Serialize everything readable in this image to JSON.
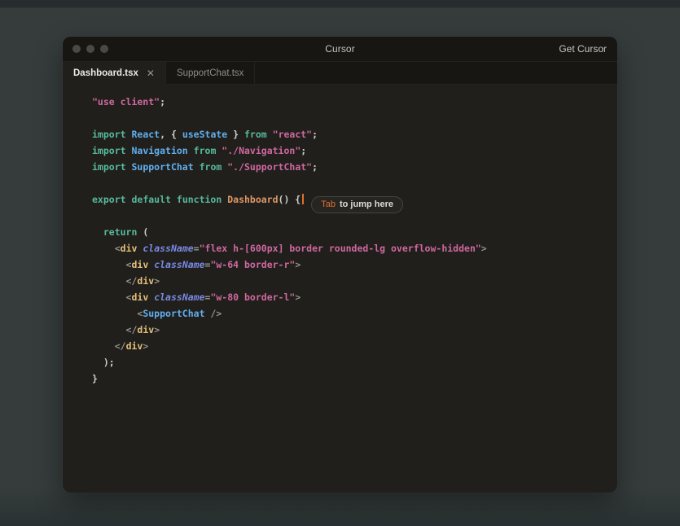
{
  "window": {
    "title": "Cursor",
    "action": "Get Cursor"
  },
  "tabs": [
    {
      "label": "Dashboard.tsx",
      "active": true
    },
    {
      "label": "SupportChat.tsx",
      "active": false
    }
  ],
  "icons": {
    "close_tab": "✕"
  },
  "inline_hint": {
    "key": "Tab",
    "text": "to jump here"
  },
  "colors": {
    "accent": "#e0702f",
    "keyword": "#57b99d",
    "component": "#61afef",
    "string": "#cf68a0",
    "tag": "#e5c07b",
    "attr": "#7b89e5",
    "func": "#dd9866",
    "plain": "#cfcfcb",
    "punct": "#95958f"
  },
  "code": {
    "lines": [
      [
        {
          "t": "\"use client\"",
          "c": "string"
        },
        {
          "t": ";",
          "c": "plain"
        }
      ],
      [],
      [
        {
          "t": "import",
          "c": "keyword"
        },
        {
          "t": " ",
          "c": "plain"
        },
        {
          "t": "React",
          "c": "component"
        },
        {
          "t": ", ",
          "c": "plain"
        },
        {
          "t": "{ ",
          "c": "plain"
        },
        {
          "t": "useState",
          "c": "component"
        },
        {
          "t": " } ",
          "c": "plain"
        },
        {
          "t": "from",
          "c": "keyword"
        },
        {
          "t": " ",
          "c": "plain"
        },
        {
          "t": "\"react\"",
          "c": "string"
        },
        {
          "t": ";",
          "c": "plain"
        }
      ],
      [
        {
          "t": "import",
          "c": "keyword"
        },
        {
          "t": " ",
          "c": "plain"
        },
        {
          "t": "Navigation",
          "c": "component"
        },
        {
          "t": " ",
          "c": "plain"
        },
        {
          "t": "from",
          "c": "keyword"
        },
        {
          "t": " ",
          "c": "plain"
        },
        {
          "t": "\"./Navigation\"",
          "c": "string"
        },
        {
          "t": ";",
          "c": "plain"
        }
      ],
      [
        {
          "t": "import",
          "c": "keyword"
        },
        {
          "t": " ",
          "c": "plain"
        },
        {
          "t": "SupportChat",
          "c": "component"
        },
        {
          "t": " ",
          "c": "plain"
        },
        {
          "t": "from",
          "c": "keyword"
        },
        {
          "t": " ",
          "c": "plain"
        },
        {
          "t": "\"./SupportChat\"",
          "c": "string"
        },
        {
          "t": ";",
          "c": "plain"
        }
      ],
      [],
      [
        {
          "t": "export",
          "c": "keyword"
        },
        {
          "t": " ",
          "c": "plain"
        },
        {
          "t": "default",
          "c": "keyword"
        },
        {
          "t": " ",
          "c": "plain"
        },
        {
          "t": "function",
          "c": "keyword"
        },
        {
          "t": " ",
          "c": "plain"
        },
        {
          "t": "Dashboard",
          "c": "func"
        },
        {
          "t": "() {",
          "c": "plain"
        },
        {
          "k": "cursor"
        },
        {
          "k": "hint"
        }
      ],
      [],
      [
        {
          "t": "  ",
          "c": "plain"
        },
        {
          "t": "return",
          "c": "keyword"
        },
        {
          "t": " (",
          "c": "plain"
        }
      ],
      [
        {
          "t": "    ",
          "c": "plain"
        },
        {
          "t": "<",
          "c": "punct"
        },
        {
          "t": "div",
          "c": "tag"
        },
        {
          "t": " ",
          "c": "plain"
        },
        {
          "t": "className",
          "c": "attr",
          "i": true
        },
        {
          "t": "=",
          "c": "punct"
        },
        {
          "t": "\"flex h-[600px] border rounded-lg overflow-hidden\"",
          "c": "string"
        },
        {
          "t": ">",
          "c": "punct"
        }
      ],
      [
        {
          "t": "      ",
          "c": "plain"
        },
        {
          "t": "<",
          "c": "punct"
        },
        {
          "t": "div",
          "c": "tag"
        },
        {
          "t": " ",
          "c": "plain"
        },
        {
          "t": "className",
          "c": "attr",
          "i": true
        },
        {
          "t": "=",
          "c": "punct"
        },
        {
          "t": "\"w-64 border-r\"",
          "c": "string"
        },
        {
          "t": ">",
          "c": "punct"
        }
      ],
      [
        {
          "t": "      ",
          "c": "plain"
        },
        {
          "t": "</",
          "c": "punct"
        },
        {
          "t": "div",
          "c": "tag"
        },
        {
          "t": ">",
          "c": "punct"
        }
      ],
      [
        {
          "t": "      ",
          "c": "plain"
        },
        {
          "t": "<",
          "c": "punct"
        },
        {
          "t": "div",
          "c": "tag"
        },
        {
          "t": " ",
          "c": "plain"
        },
        {
          "t": "className",
          "c": "attr",
          "i": true
        },
        {
          "t": "=",
          "c": "punct"
        },
        {
          "t": "\"w-80 border-l\"",
          "c": "string"
        },
        {
          "t": ">",
          "c": "punct"
        }
      ],
      [
        {
          "t": "        ",
          "c": "plain"
        },
        {
          "t": "<",
          "c": "punct"
        },
        {
          "t": "SupportChat",
          "c": "component"
        },
        {
          "t": " />",
          "c": "punct"
        }
      ],
      [
        {
          "t": "      ",
          "c": "plain"
        },
        {
          "t": "</",
          "c": "punct"
        },
        {
          "t": "div",
          "c": "tag"
        },
        {
          "t": ">",
          "c": "punct"
        }
      ],
      [
        {
          "t": "    ",
          "c": "plain"
        },
        {
          "t": "</",
          "c": "punct"
        },
        {
          "t": "div",
          "c": "tag"
        },
        {
          "t": ">",
          "c": "punct"
        }
      ],
      [
        {
          "t": "  );",
          "c": "plain"
        }
      ],
      [
        {
          "t": "}",
          "c": "plain"
        }
      ]
    ]
  }
}
